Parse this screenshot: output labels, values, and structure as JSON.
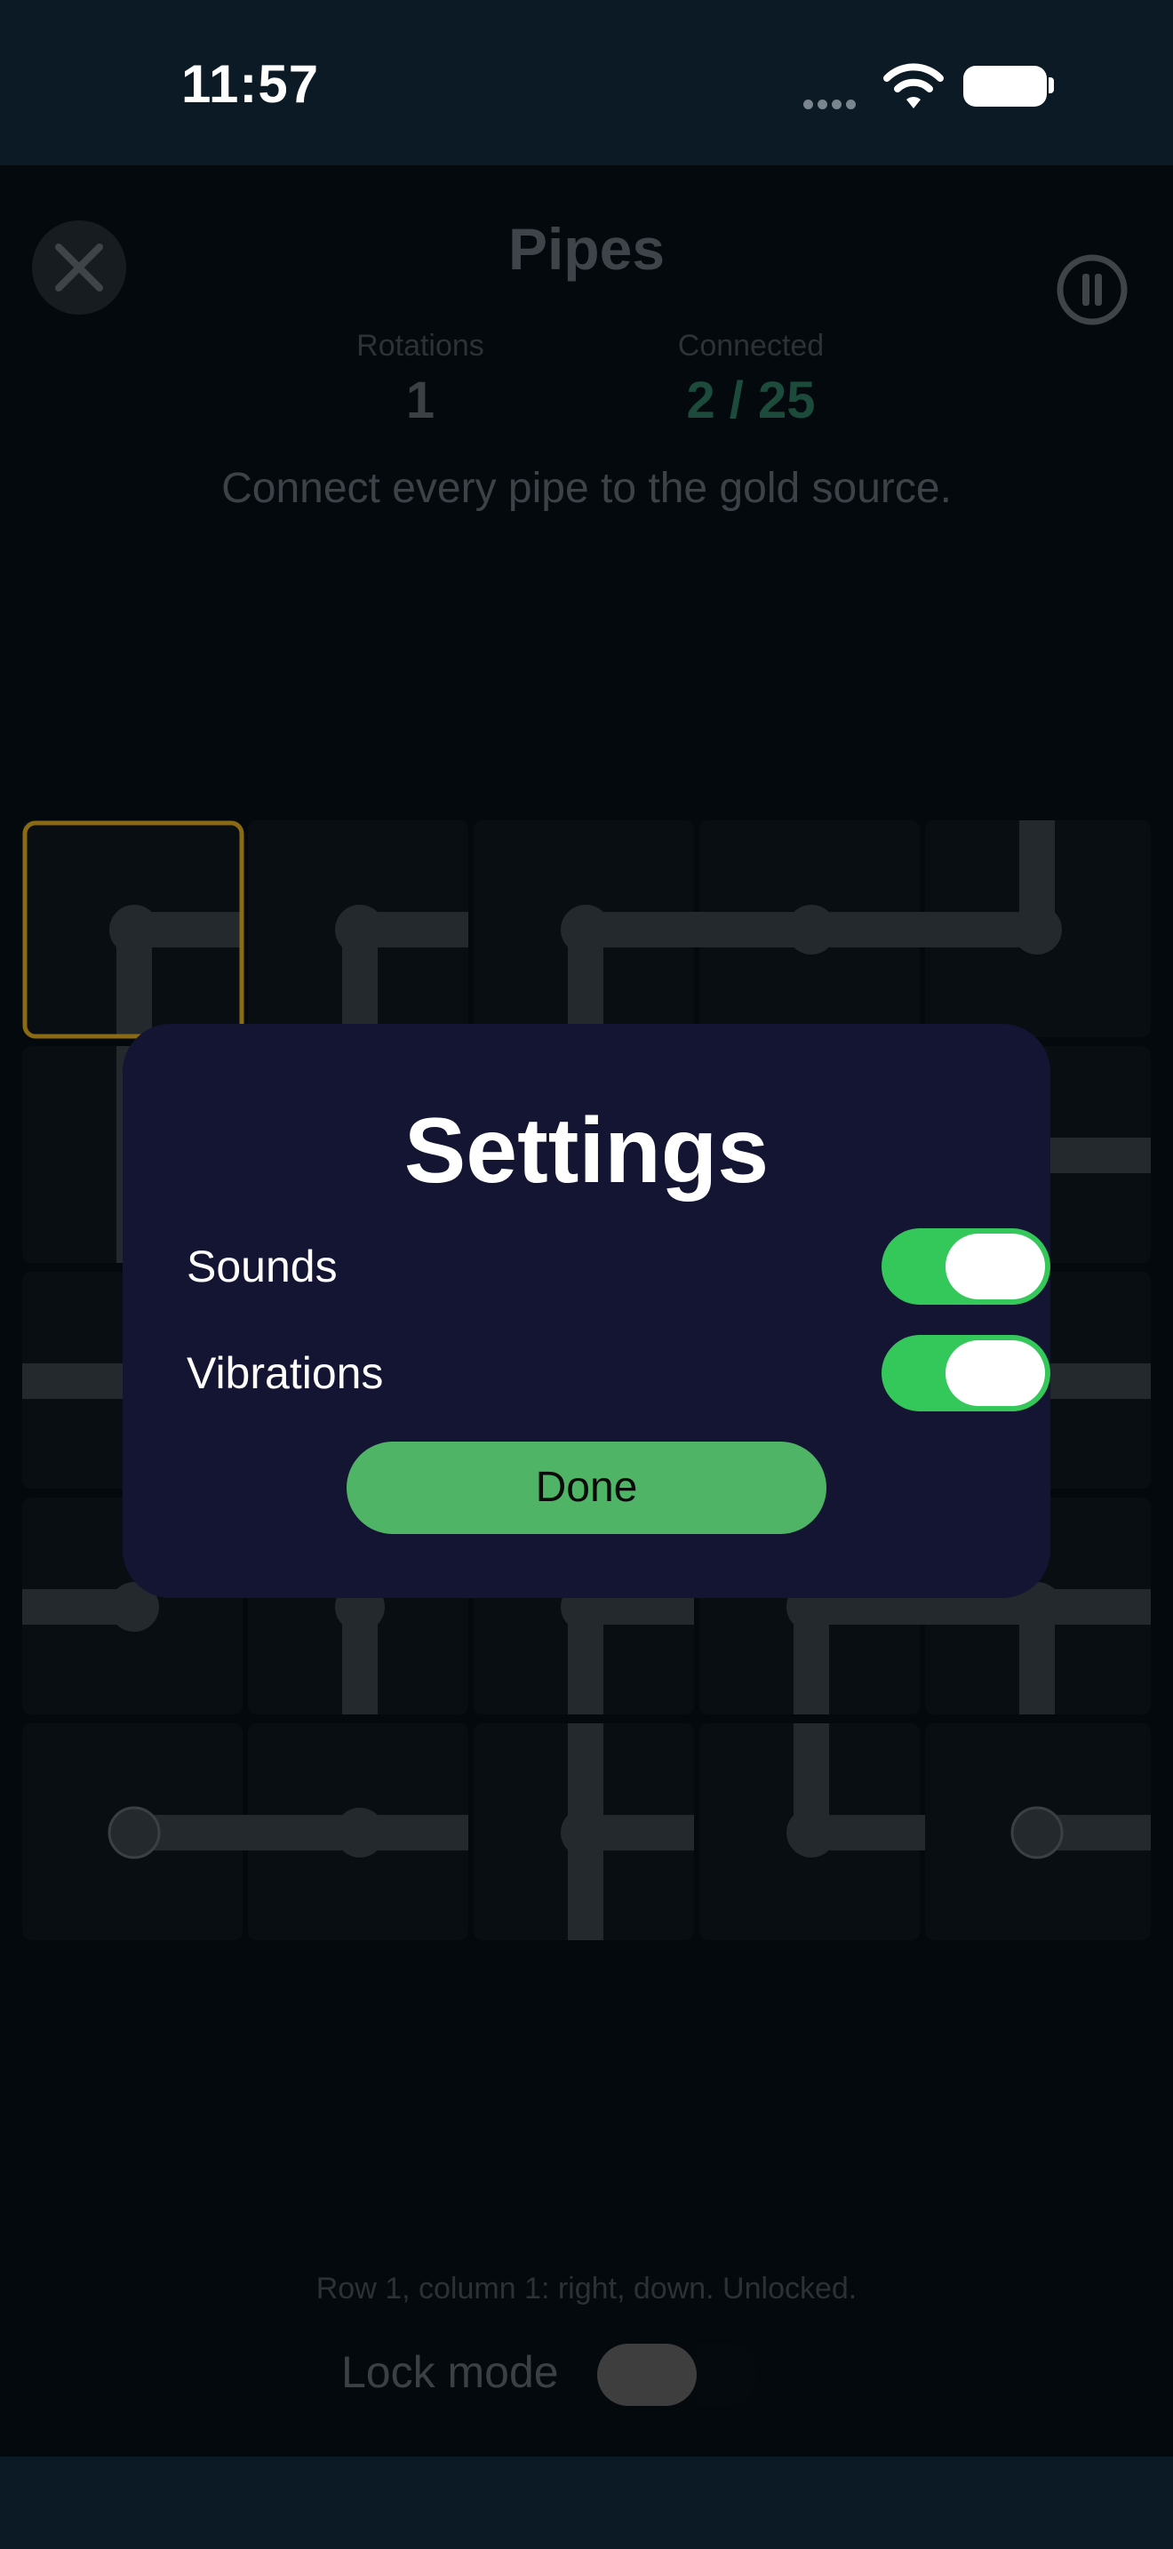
{
  "status_bar": {
    "time": "11:57"
  },
  "header": {
    "title": "Pipes",
    "close_icon": "close-icon",
    "pause_icon": "pause-icon"
  },
  "stats": {
    "rotations_label": "Rotations",
    "rotations_value": "1",
    "connected_label": "Connected",
    "connected_value": "2 / 25"
  },
  "instruction": "Connect every pipe to the gold source.",
  "board": {
    "rows": 5,
    "columns": 5,
    "connected": 2,
    "total": 25,
    "selected_cell": "row 1, column 1"
  },
  "a11y_text": "Row 1, column 1: right, down. Unlocked.",
  "lock_mode": {
    "label": "Lock mode",
    "on": false
  },
  "settings_dialog": {
    "title": "Settings",
    "sounds_label": "Sounds",
    "sounds_on": true,
    "vibrations_label": "Vibrations",
    "vibrations_on": true,
    "done_label": "Done"
  },
  "colors": {
    "toggle_on": "#34c759",
    "done_button": "#50b466",
    "dialog_bg": "#141433",
    "selected_cell_border": "#8a6a12",
    "connected_text": "#1c4a3b"
  }
}
